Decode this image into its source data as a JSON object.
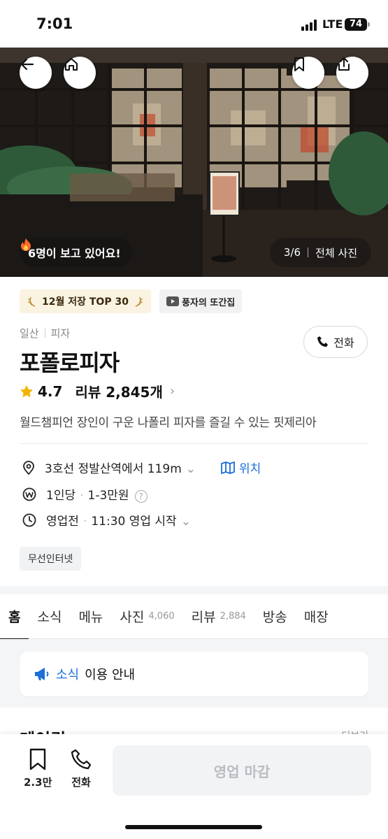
{
  "status_bar": {
    "time": "7:01",
    "network": "LTE",
    "battery": "74"
  },
  "hero": {
    "viewers_text": "6명이 보고 있어요!",
    "photo_counter": "3/6",
    "all_photos_label": "전체 사진",
    "icons": [
      "back-arrow-icon",
      "home-icon",
      "bookmark-icon",
      "share-icon",
      "fire-icon"
    ]
  },
  "badges": {
    "top30": "12월 저장 TOP 30",
    "tv": "풍자의 또간집"
  },
  "store": {
    "region": "일산",
    "category": "피자",
    "name": "포폴로피자",
    "rating": "4.7",
    "reviews": "리뷰 2,845개",
    "description": "월드챔피언 장인이 구운 나폴리 피자를 즐길 수 있는 핏제리아",
    "call_label": "전화"
  },
  "info": {
    "location": "3호선 정발산역에서 119m",
    "location_link": "위치",
    "price_label": "1인당",
    "price_range": "1-3만원",
    "status": "영업전",
    "hours": "11:30 영업 시작"
  },
  "amenities": [
    "무선인터넷"
  ],
  "tabs": [
    {
      "label": "홈",
      "count": ""
    },
    {
      "label": "소식",
      "count": ""
    },
    {
      "label": "메뉴",
      "count": ""
    },
    {
      "label": "사진",
      "count": "4,060"
    },
    {
      "label": "리뷰",
      "count": "2,884"
    },
    {
      "label": "방송",
      "count": ""
    },
    {
      "label": "매장",
      "count": ""
    }
  ],
  "notice": {
    "highlight": "소식",
    "text": "이용 안내"
  },
  "partial_section": {
    "title": "메이킹",
    "right": "더보기"
  },
  "bottom_bar": {
    "save_count": "2.3만",
    "call_label": "전화",
    "closed_label": "영업 마감"
  },
  "colors": {
    "accent_blue": "#1c6ed8",
    "star": "#f5b300",
    "closed_text": "#b9bcc1"
  }
}
